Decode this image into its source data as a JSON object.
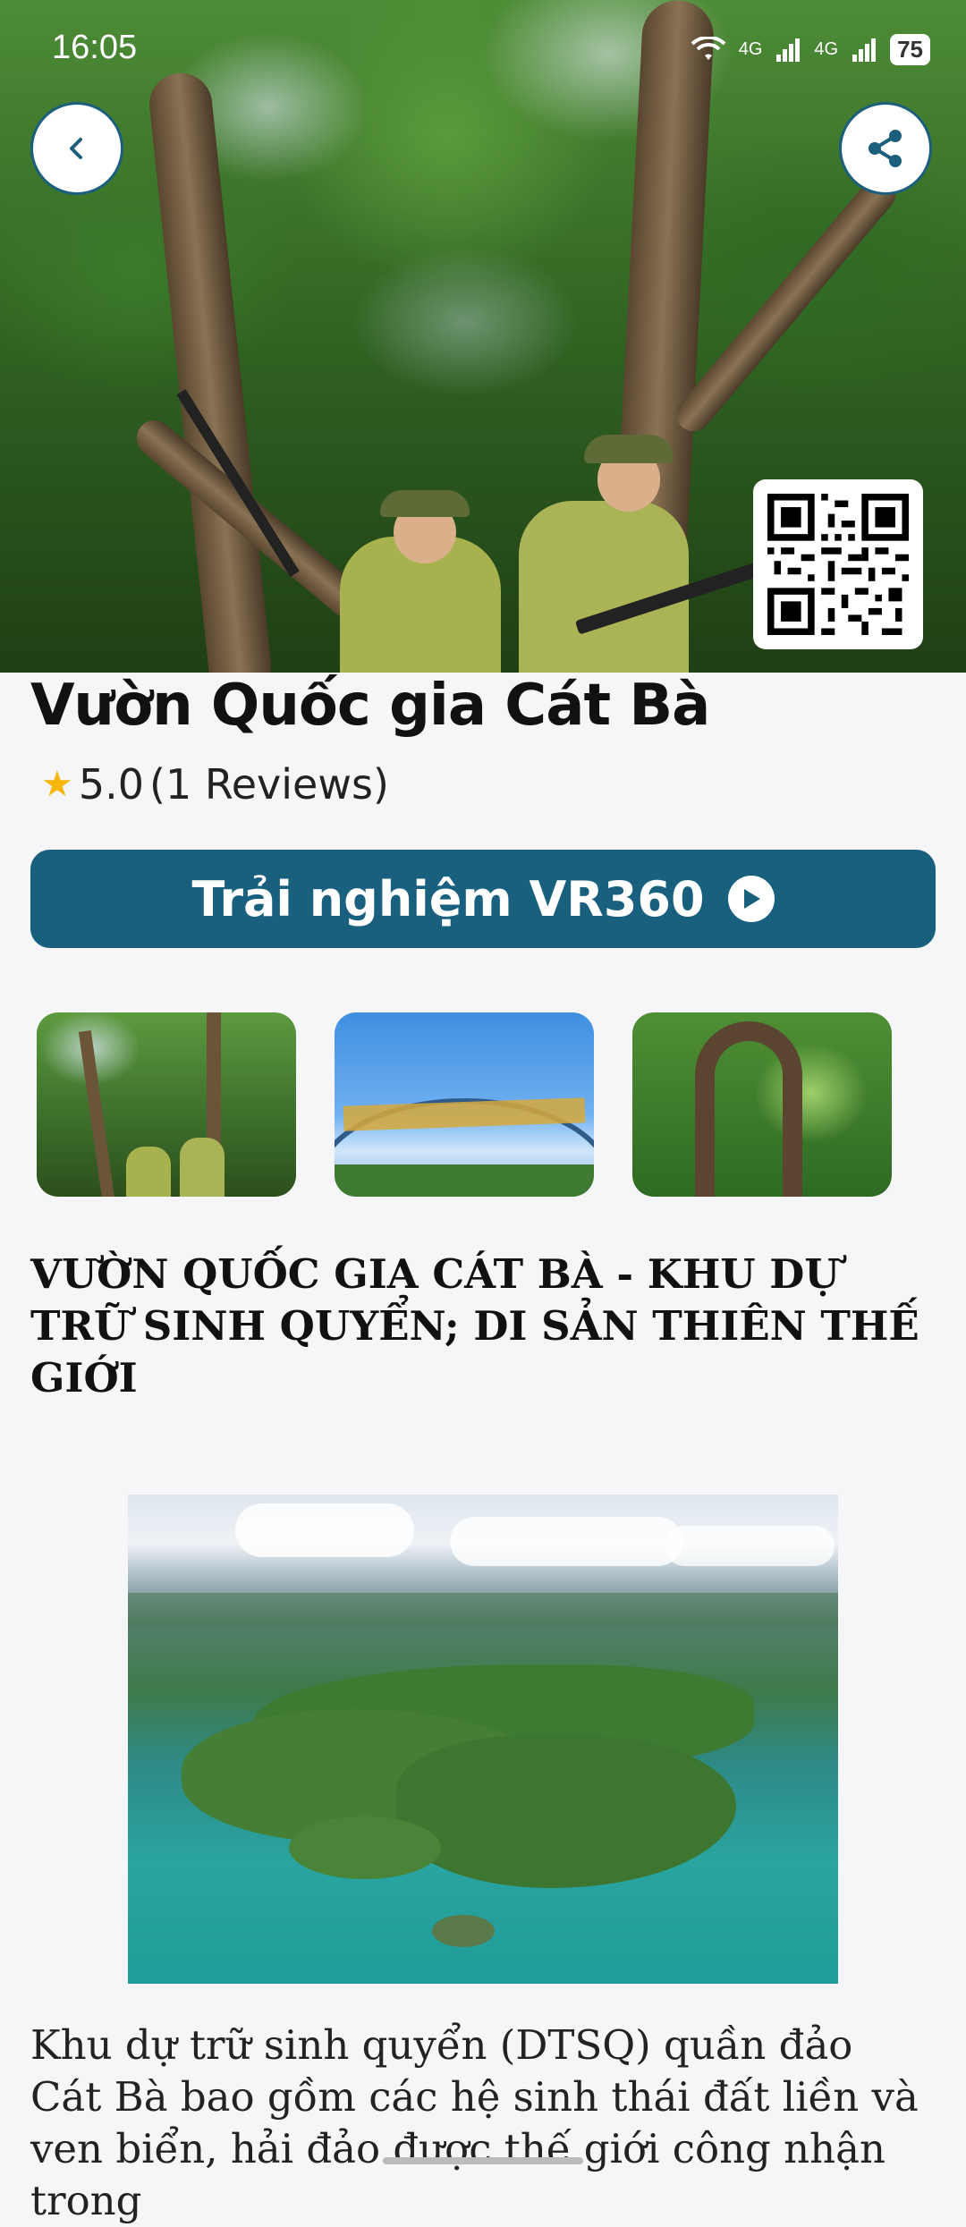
{
  "status_bar": {
    "time": "16:05",
    "network_1": "4G",
    "network_2": "4G",
    "battery": "75"
  },
  "header": {
    "back_icon": "chevron-left-icon",
    "share_icon": "share-icon",
    "qr_icon": "qr-code-icon"
  },
  "place": {
    "title": "Vườn Quốc gia Cát Bà",
    "rating": "5.0",
    "reviews": "(1 Reviews)"
  },
  "vr_button": {
    "label": "Trải nghiệm VR360",
    "icon": "play-circle-icon"
  },
  "article": {
    "heading": "VƯỜN QUỐC GIA CÁT BÀ - KHU DỰ TRỮ SINH QUYỂN; DI SẢN THIÊN THẾ GIỚI",
    "body": "Khu dự trữ sinh quyển (DTSQ) quần đảo Cát Bà bao gồm các hệ sinh thái đất liền và ven biển, hải đảo được thế giới công nhận trong"
  },
  "colors": {
    "primary": "#19607f",
    "star": "#f5b80a",
    "background": "#f6f6f8"
  }
}
